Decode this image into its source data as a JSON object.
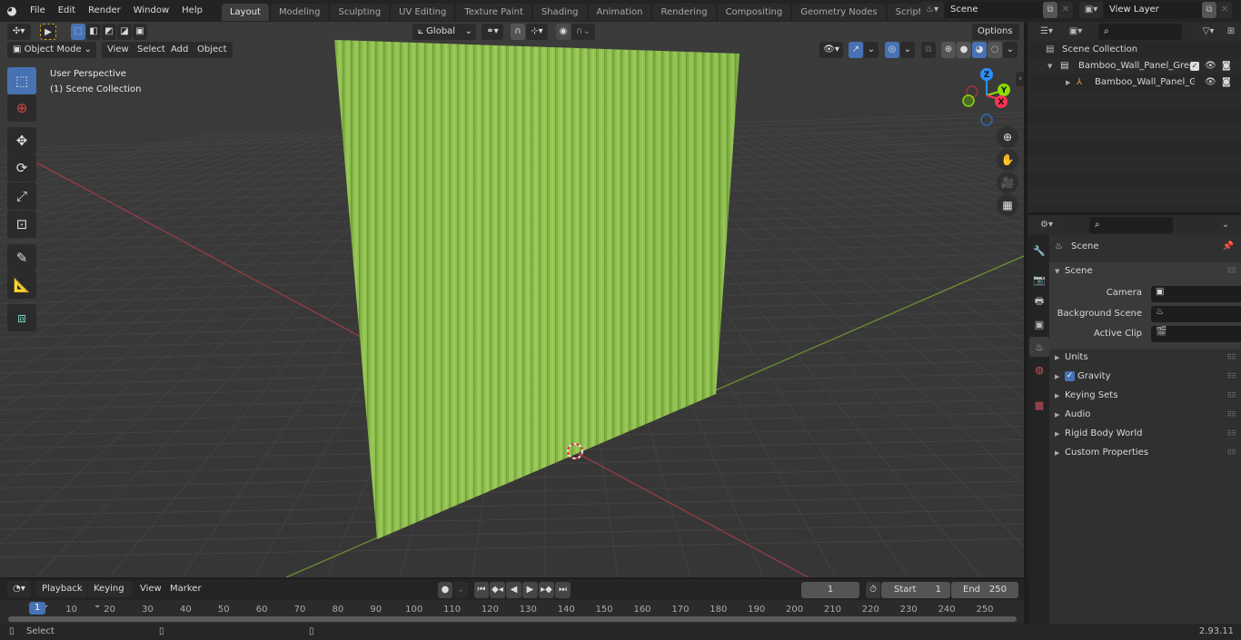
{
  "menubar": {
    "logo_icon": "blender-logo-icon",
    "items": [
      "File",
      "Edit",
      "Render",
      "Window",
      "Help"
    ],
    "workspace_tabs": [
      {
        "label": "Layout",
        "active": true
      },
      {
        "label": "Modeling",
        "active": false
      },
      {
        "label": "Sculpting",
        "active": false
      },
      {
        "label": "UV Editing",
        "active": false
      },
      {
        "label": "Texture Paint",
        "active": false
      },
      {
        "label": "Shading",
        "active": false
      },
      {
        "label": "Animation",
        "active": false
      },
      {
        "label": "Rendering",
        "active": false
      },
      {
        "label": "Compositing",
        "active": false
      },
      {
        "label": "Geometry Nodes",
        "active": false
      },
      {
        "label": "Scripting",
        "active": false
      }
    ],
    "add_tab_label": "+",
    "scene_name": "Scene",
    "view_layer_name": "View Layer"
  },
  "viewport": {
    "mode": "Object Mode",
    "menus": [
      "View",
      "Select",
      "Add",
      "Object"
    ],
    "transform_orientation": "Global",
    "options_label": "Options",
    "overlay_title": "User Perspective",
    "overlay_subtitle": "(1) Scene Collection",
    "tools": [
      "select-box",
      "cursor",
      "move",
      "rotate",
      "scale",
      "transform",
      "annotate",
      "measure",
      "add-cube"
    ],
    "gizmo_axes": {
      "x": "X",
      "y": "Y",
      "z": "Z"
    },
    "axis_colors": {
      "x": "#ff3352",
      "y": "#8bdc00",
      "z": "#2890ff"
    },
    "object_color": "#8fc450",
    "shading_mode": "solid-material-preview"
  },
  "outliner": {
    "search_placeholder": "",
    "root": "Scene Collection",
    "items": [
      {
        "label": "Bamboo_Wall_Panel_Green_C",
        "type": "collection",
        "checked": true
      },
      {
        "label": "Bamboo_Wall_Panel_Gre",
        "type": "object"
      }
    ]
  },
  "properties": {
    "search_placeholder": "",
    "context_title": "Scene",
    "section_title": "Scene",
    "fields": [
      {
        "label": "Camera",
        "value": ""
      },
      {
        "label": "Background Scene",
        "value": ""
      },
      {
        "label": "Active Clip",
        "value": ""
      }
    ],
    "panels": [
      {
        "label": "Units"
      },
      {
        "label": "Gravity",
        "checkbox": true
      },
      {
        "label": "Keying Sets"
      },
      {
        "label": "Audio"
      },
      {
        "label": "Rigid Body World"
      },
      {
        "label": "Custom Properties"
      }
    ]
  },
  "timeline": {
    "menus": [
      "Playback",
      "Keying",
      "View",
      "Marker"
    ],
    "current_frame": "1",
    "start_label": "Start",
    "start_value": "1",
    "end_label": "End",
    "end_value": "250",
    "ruler": [
      "10",
      "20",
      "30",
      "40",
      "50",
      "60",
      "70",
      "80",
      "90",
      "100",
      "110",
      "120",
      "130",
      "140",
      "150",
      "160",
      "170",
      "180",
      "190",
      "200",
      "210",
      "220",
      "230",
      "240",
      "250"
    ],
    "cursor_frame": "1"
  },
  "statusbar": {
    "left_action": "Select",
    "version": "2.93.11"
  }
}
